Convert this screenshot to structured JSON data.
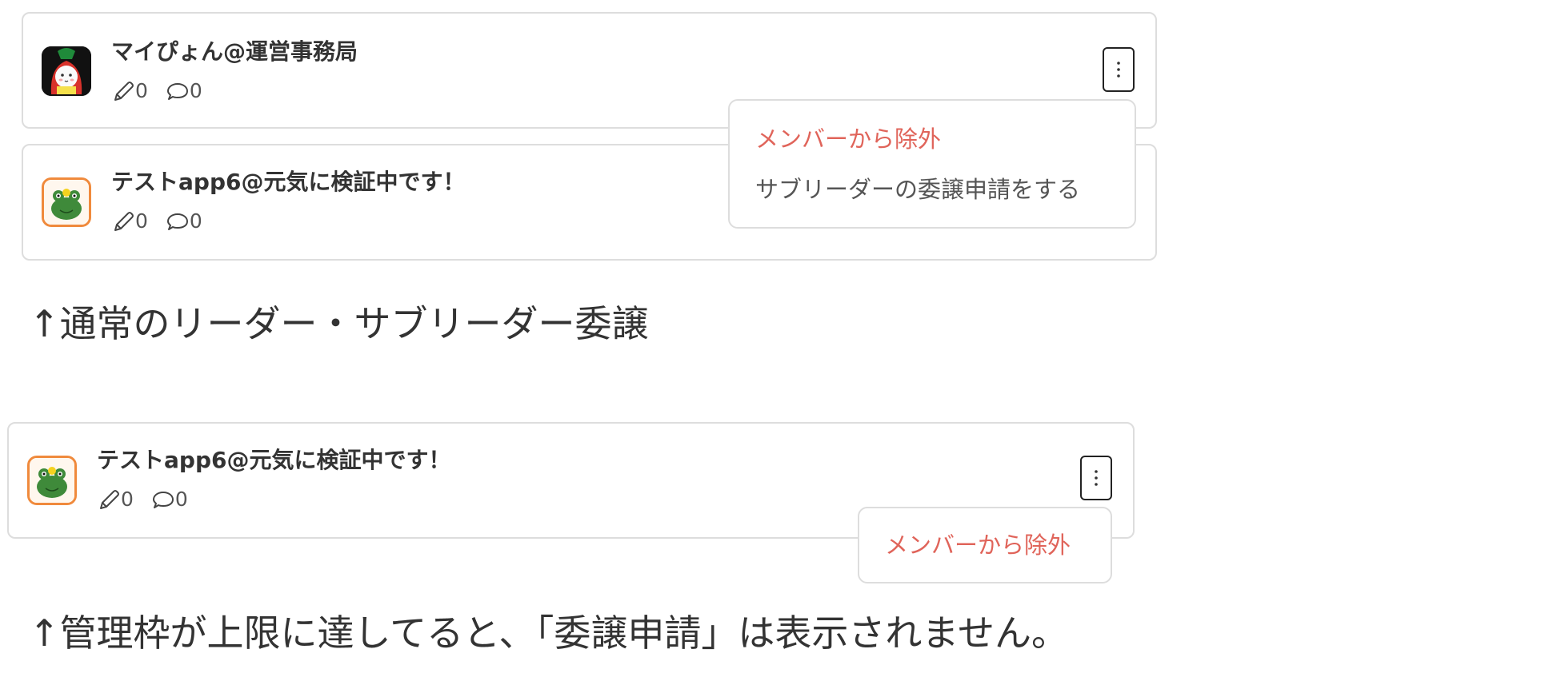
{
  "section1": {
    "members": [
      {
        "name": "マイぴょん@運営事務局",
        "posts": "0",
        "comments": "0",
        "avatar": "rabbit-avatar"
      },
      {
        "name": "テストapp6@元気に検証中です！",
        "posts": "0",
        "comments": "0",
        "avatar": "frog-avatar"
      }
    ],
    "menu": {
      "remove": "メンバーから除外",
      "delegate": "サブリーダーの委譲申請をする"
    },
    "caption": "↑通常のリーダー・サブリーダー委譲"
  },
  "section2": {
    "member": {
      "name": "テストapp6@元気に検証中です！",
      "posts": "0",
      "comments": "0",
      "avatar": "frog-avatar"
    },
    "menu": {
      "remove": "メンバーから除外"
    },
    "caption": "↑管理枠が上限に達してると、「委譲申請」は表示されません。"
  },
  "colors": {
    "danger": "#e0645a",
    "border": "#dddddd",
    "text": "#333333",
    "avatar_frog_border": "#f08a3c"
  }
}
